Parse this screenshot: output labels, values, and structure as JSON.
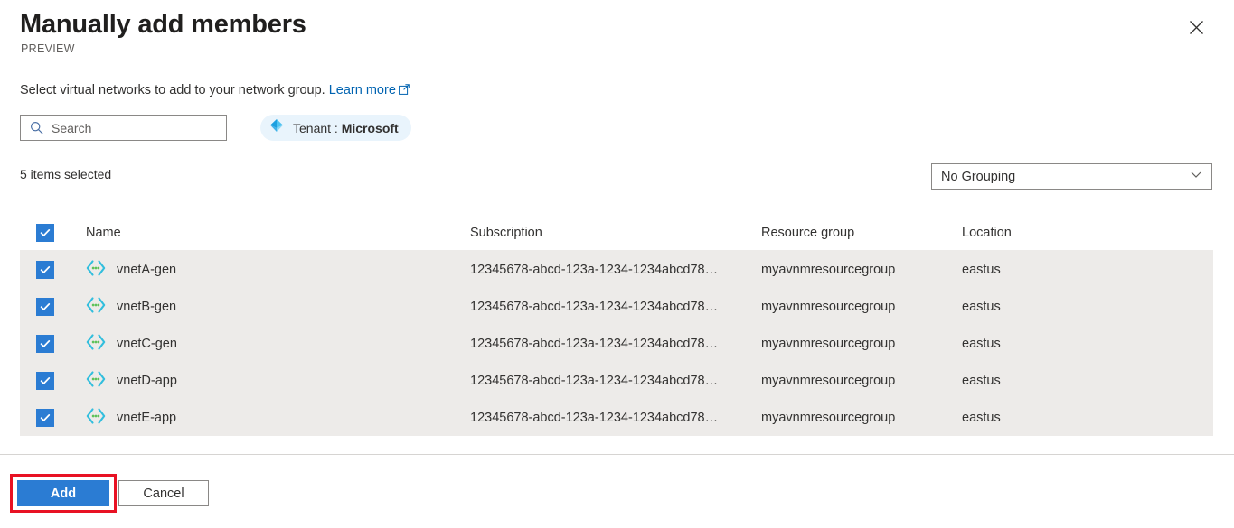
{
  "header": {
    "title": "Manually add members",
    "preview_tag": "PREVIEW",
    "close_icon": "close-icon"
  },
  "description": {
    "text": "Select virtual networks to add to your network group.",
    "link_label": "Learn more",
    "link_external_icon": "external-link-icon"
  },
  "toolbar": {
    "search_placeholder": "Search",
    "search_value": "",
    "search_icon": "search-icon",
    "tenant_chip": {
      "icon": "azure-tenant-icon",
      "prefix": "Tenant : ",
      "value": "Microsoft"
    }
  },
  "status": {
    "items_selected": "5 items selected"
  },
  "grouping": {
    "selected": "No Grouping",
    "chevron_icon": "chevron-down-icon",
    "options": [
      "No Grouping"
    ]
  },
  "table": {
    "select_all_checked": true,
    "columns": {
      "name": "Name",
      "subscription": "Subscription",
      "resource_group": "Resource group",
      "location": "Location"
    },
    "rows": [
      {
        "checked": true,
        "icon": "virtual-network-icon",
        "name": "vnetA-gen",
        "subscription": "12345678-abcd-123a-1234-1234abcd78…",
        "resource_group": "myavnmresourcegroup",
        "location": "eastus"
      },
      {
        "checked": true,
        "icon": "virtual-network-icon",
        "name": "vnetB-gen",
        "subscription": "12345678-abcd-123a-1234-1234abcd78…",
        "resource_group": "myavnmresourcegroup",
        "location": "eastus"
      },
      {
        "checked": true,
        "icon": "virtual-network-icon",
        "name": "vnetC-gen",
        "subscription": "12345678-abcd-123a-1234-1234abcd78…",
        "resource_group": "myavnmresourcegroup",
        "location": "eastus"
      },
      {
        "checked": true,
        "icon": "virtual-network-icon",
        "name": "vnetD-app",
        "subscription": "12345678-abcd-123a-1234-1234abcd78…",
        "resource_group": "myavnmresourcegroup",
        "location": "eastus"
      },
      {
        "checked": true,
        "icon": "virtual-network-icon",
        "name": "vnetE-app",
        "subscription": "12345678-abcd-123a-1234-1234abcd78…",
        "resource_group": "myavnmresourcegroup",
        "location": "eastus"
      }
    ]
  },
  "footer": {
    "add_label": "Add",
    "cancel_label": "Cancel"
  },
  "colors": {
    "primary_blue": "#2b7cd3",
    "link_blue": "#0063b1",
    "chip_background": "#e9f4fc",
    "row_selected_background": "#edebe9",
    "annotation_red": "#e81123"
  }
}
